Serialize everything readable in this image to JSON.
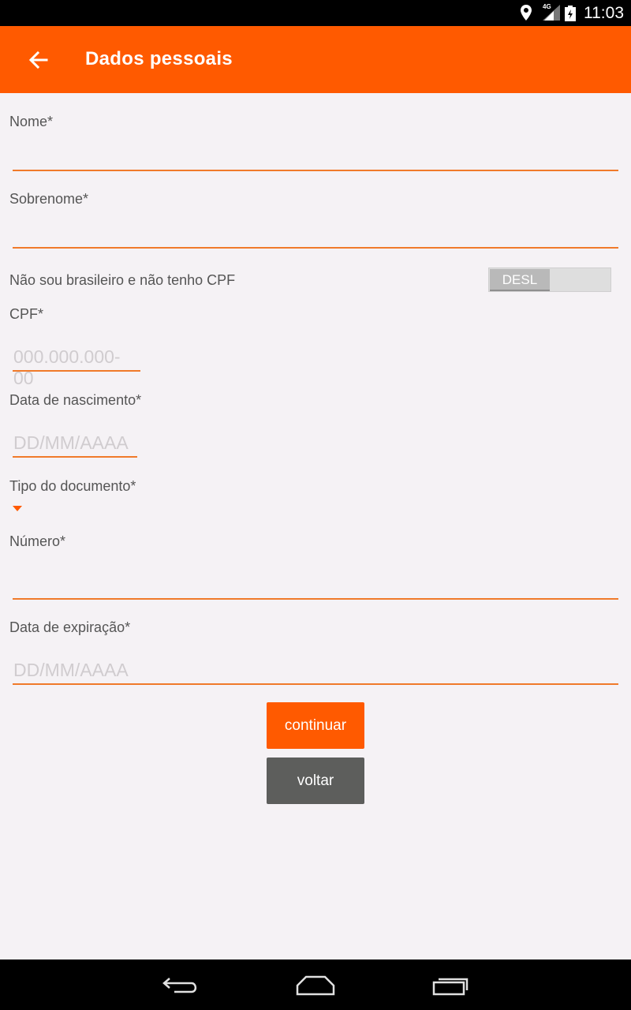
{
  "status_bar": {
    "time": "11:03",
    "network": "4G",
    "icons": [
      "location-icon",
      "signal-icon",
      "battery-icon"
    ]
  },
  "app_bar": {
    "title": "Dados pessoais",
    "back_icon": "arrow-left-icon",
    "color": "#ff5a00"
  },
  "form": {
    "nome_label": "Nome*",
    "nome_value": "",
    "sobrenome_label": "Sobrenome*",
    "sobrenome_value": "",
    "foreigner_label": "Não sou brasileiro e não tenho CPF",
    "foreigner_toggle": "DESL",
    "cpf_label": "CPF*",
    "cpf_placeholder": "000.000.000-00",
    "birth_label": "Data de nascimento*",
    "birth_placeholder": "DD/MM/AAAA",
    "doc_type_label": "Tipo do documento*",
    "numero_label": "Número*",
    "numero_value": "",
    "expiry_label": "Data de expiração*",
    "expiry_placeholder": "DD/MM/AAAA"
  },
  "actions": {
    "continue_label": "continuar",
    "back_label": "voltar"
  },
  "nav_bar": {
    "icons": [
      "back-nav-icon",
      "home-nav-icon",
      "recents-nav-icon"
    ]
  }
}
